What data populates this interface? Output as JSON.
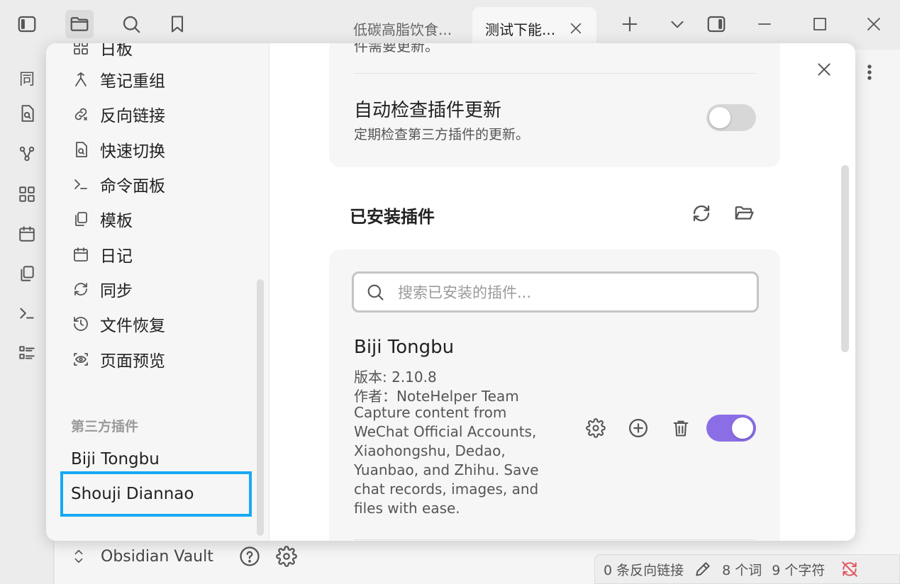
{
  "tabs": [
    {
      "label": "低碳高脂饮食..."
    },
    {
      "label": "测试下能..."
    }
  ],
  "icons": {
    "sidebar_toggle": "sidebar-toggle-icon",
    "files": "folder-icon",
    "search": "search-icon",
    "bookmark": "bookmark-icon",
    "new_tab": "plus-icon",
    "tab_list": "chevron-down-icon",
    "right_sidebar": "right-sidebar-icon",
    "minimize": "minimize-icon",
    "maximize": "maximize-icon",
    "close": "close-icon"
  },
  "ribbon": {
    "items": [
      "同",
      "search-file-icon",
      "graph-icon",
      "canvas-icon",
      "calendar-icon",
      "copy-icon",
      "terminal-icon",
      "list-icon"
    ]
  },
  "settings_sidebar": {
    "partial_item": "日板",
    "items": [
      {
        "label": "笔记重组",
        "icon": "merge-icon"
      },
      {
        "label": "反向链接",
        "icon": "link-icon"
      },
      {
        "label": "快速切换",
        "icon": "file-search-icon"
      },
      {
        "label": "命令面板",
        "icon": "terminal-icon"
      },
      {
        "label": "模板",
        "icon": "template-icon"
      },
      {
        "label": "日记",
        "icon": "calendar-icon"
      },
      {
        "label": "同步",
        "icon": "sync-icon"
      },
      {
        "label": "文件恢复",
        "icon": "history-icon"
      },
      {
        "label": "页面预览",
        "icon": "preview-icon"
      }
    ],
    "section_title": "第三方插件",
    "plugins": [
      {
        "label": "Biji Tongbu"
      },
      {
        "label": "Shouji Diannao"
      }
    ]
  },
  "content": {
    "cut_text": "件需要更新。",
    "auto_check": {
      "name": "自动检查插件更新",
      "desc": "定期检查第三方插件的更新。",
      "enabled": false
    },
    "installed_heading": "已安装插件",
    "search_placeholder": "搜索已安装的插件...",
    "plugin": {
      "name": "Biji Tongbu",
      "version": "版本: 2.10.8",
      "author": "作者：NoteHelper Team",
      "description": "Capture content from WeChat Official Accounts, Xiaohongshu, Dedao, Yuanbao, and Zhihu. Save chat records, images, and files with ease.",
      "enabled": true
    }
  },
  "vault": {
    "name": "Obsidian Vault"
  },
  "status": {
    "backlinks": "0 条反向链接",
    "words": "8 个词",
    "chars": "9 个字符"
  },
  "colors": {
    "accent": "#8b6ee6",
    "highlight": "#17a9f3"
  }
}
